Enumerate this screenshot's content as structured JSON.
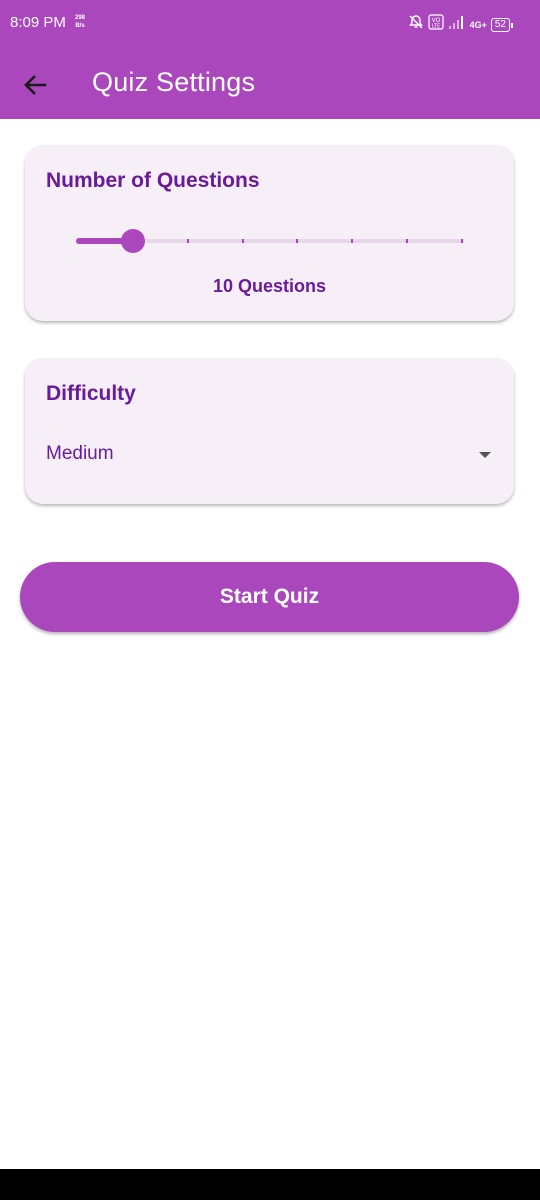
{
  "status_bar": {
    "time": "8:09 PM",
    "net_speed_value": "298",
    "net_speed_unit": "B/s",
    "network_label": "4G+",
    "battery": "52",
    "icons": [
      "bell-off-icon",
      "volte-icon",
      "signal-icon",
      "network-icon",
      "battery-icon"
    ]
  },
  "app_bar": {
    "title": "Quiz Settings",
    "back_icon": "arrow-back-icon"
  },
  "questions_card": {
    "title": "Number of Questions",
    "slider": {
      "min": 5,
      "max": 40,
      "step": 5,
      "value": 10
    },
    "value_label": "10 Questions"
  },
  "difficulty_card": {
    "title": "Difficulty",
    "selected": "Medium",
    "dropdown_icon": "arrow-drop-down-icon"
  },
  "start_button": {
    "label": "Start Quiz"
  },
  "colors": {
    "primary": "#ab47bc",
    "primary_dark_text": "#6a1b9a",
    "card_bg": "#f6eff8"
  }
}
